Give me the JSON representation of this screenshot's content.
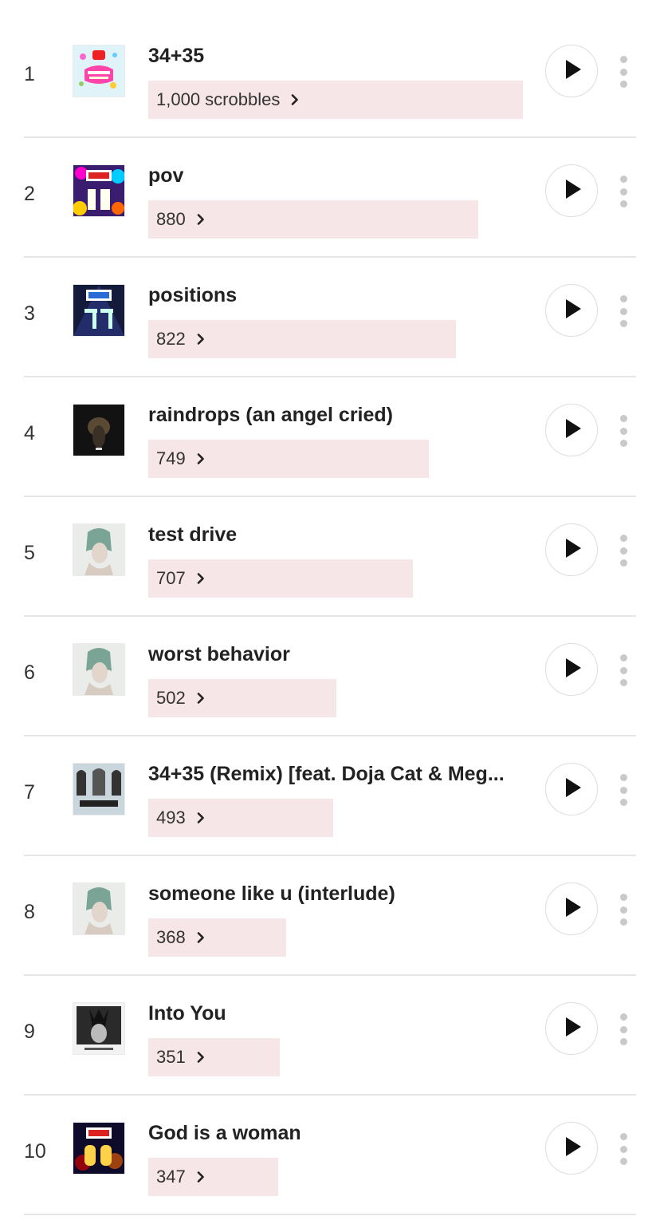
{
  "tracks": [
    {
      "rank": "1",
      "title": "34+35",
      "scrobbles": "1,000 scrobbles",
      "scrobble_value": 1000,
      "cover": "nrj-good-vibes"
    },
    {
      "rank": "2",
      "title": "pov",
      "scrobbles": "880",
      "scrobble_value": 880,
      "cover": "now-79"
    },
    {
      "rank": "3",
      "title": "positions",
      "scrobbles": "822",
      "scrobble_value": 822,
      "cover": "now-77"
    },
    {
      "rank": "4",
      "title": "raindrops (an angel cried)",
      "scrobbles": "749",
      "scrobble_value": 749,
      "cover": "eternal-sunshine"
    },
    {
      "rank": "5",
      "title": "test drive",
      "scrobbles": "707",
      "scrobble_value": 707,
      "cover": "positions-deluxe"
    },
    {
      "rank": "6",
      "title": "worst behavior",
      "scrobbles": "502",
      "scrobble_value": 502,
      "cover": "positions-deluxe"
    },
    {
      "rank": "7",
      "title": "34+35 (Remix) [feat. Doja Cat & Meg...",
      "scrobbles": "493",
      "scrobble_value": 493,
      "cover": "34-35-remix"
    },
    {
      "rank": "8",
      "title": "someone like u (interlude)",
      "scrobbles": "368",
      "scrobble_value": 368,
      "cover": "positions-deluxe"
    },
    {
      "rank": "9",
      "title": "Into You",
      "scrobbles": "351",
      "scrobble_value": 351,
      "cover": "dangerous-woman"
    },
    {
      "rank": "10",
      "title": "God is a woman",
      "scrobbles": "347",
      "scrobble_value": 347,
      "cover": "now-68"
    }
  ],
  "colors": {
    "bar_fill": "#f7e6e7",
    "divider": "#e6e6e6",
    "play_icon": "#111111",
    "more_dots": "#c9c9c9"
  },
  "icons": {
    "play": "play-icon",
    "more": "more-vertical-icon",
    "chevron": "chevron-right-icon"
  }
}
